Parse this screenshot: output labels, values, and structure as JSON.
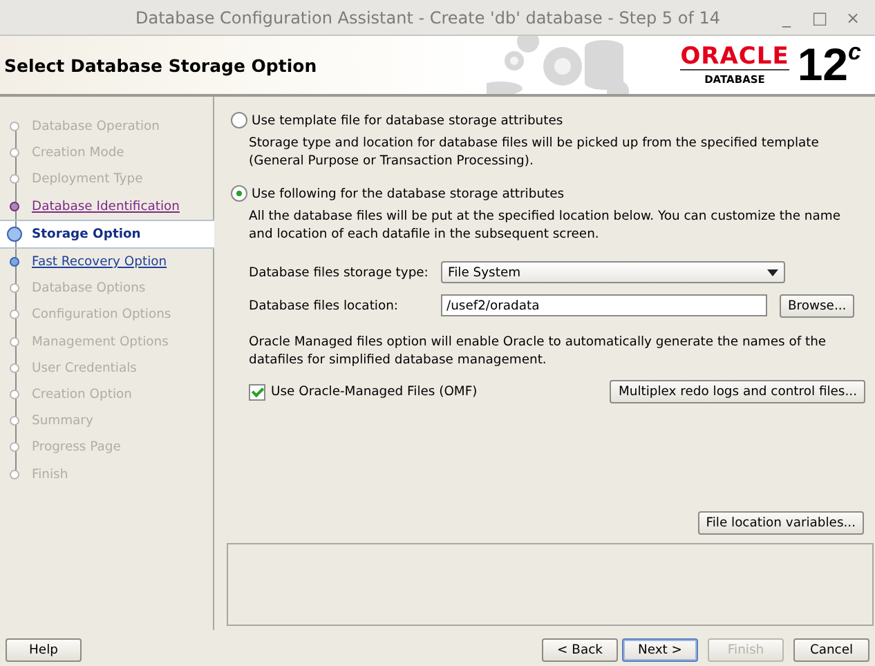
{
  "window": {
    "title": "Database Configuration Assistant - Create 'db' database - Step 5 of 14",
    "controls": [
      "_",
      "□",
      "×"
    ]
  },
  "header": {
    "title": "Select Database Storage Option",
    "logo": {
      "brand": "ORACLE",
      "product": "DATABASE",
      "version": "12",
      "version_sup": "c"
    }
  },
  "steps": [
    {
      "label": "Database Operation",
      "kind": "done",
      "selected": false
    },
    {
      "label": "Creation Mode",
      "kind": "done",
      "selected": false
    },
    {
      "label": "Deployment Type",
      "kind": "done",
      "selected": false
    },
    {
      "label": "Database Identification",
      "kind": "visited",
      "selected": false
    },
    {
      "label": "Storage Option",
      "kind": "current",
      "selected": true
    },
    {
      "label": "Fast Recovery Option",
      "kind": "link",
      "selected": false
    },
    {
      "label": "Database Options",
      "kind": "pending",
      "selected": false
    },
    {
      "label": "Configuration Options",
      "kind": "pending",
      "selected": false
    },
    {
      "label": "Management Options",
      "kind": "pending",
      "selected": false
    },
    {
      "label": "User Credentials",
      "kind": "pending",
      "selected": false
    },
    {
      "label": "Creation Option",
      "kind": "pending",
      "selected": false
    },
    {
      "label": "Summary",
      "kind": "pending",
      "selected": false
    },
    {
      "label": "Progress Page",
      "kind": "pending",
      "selected": false
    },
    {
      "label": "Finish",
      "kind": "pending",
      "selected": false
    }
  ],
  "options": [
    {
      "label": "Use template file for database storage attributes",
      "selected": false,
      "description": "Storage type and location for database files will be picked up from the specified template (General Purpose or Transaction Processing)."
    },
    {
      "label": "Use following for the database storage attributes",
      "selected": true,
      "description": "All the database files will be put at the specified location below. You can customize the name and location of each datafile in the subsequent screen."
    }
  ],
  "storage_type": {
    "label": "Database files storage type:",
    "value": "File System"
  },
  "location": {
    "label": "Database files location:",
    "value": "/usef2/oradata",
    "button": "Browse..."
  },
  "omf": {
    "description": "Oracle Managed files option will enable Oracle to automatically generate the names of the datafiles for simplified database management.",
    "label": "Use Oracle-Managed Files (OMF)",
    "checked": true,
    "button": "Multiplex redo logs and control files..."
  },
  "file_location_button": "File location variables...",
  "footer": {
    "help": "Help",
    "buttons": [
      {
        "label": "< Back",
        "disabled": false,
        "selected": false
      },
      {
        "label": "Next >",
        "disabled": false,
        "selected": true
      },
      {
        "label": "Finish",
        "disabled": true,
        "selected": false
      },
      {
        "label": "Cancel",
        "disabled": false,
        "selected": false
      }
    ]
  }
}
